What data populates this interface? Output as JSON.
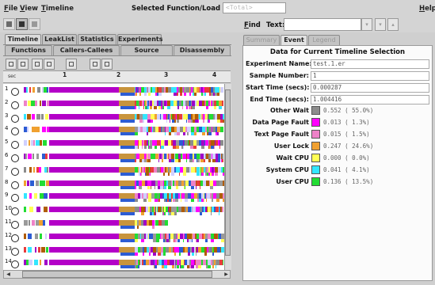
{
  "menubar": {
    "items": [
      {
        "label": "File",
        "hot": "F",
        "rest": "ile"
      },
      {
        "label": "View",
        "hot": "V",
        "rest": "iew"
      },
      {
        "label": "Timeline",
        "hot": "T",
        "rest": "imeline"
      }
    ],
    "help": {
      "hot": "H",
      "rest": "elp"
    },
    "selected_label": "Selected Function/Load Object:",
    "selected_value": "<Total>"
  },
  "find": {
    "label": "Find",
    "hot": "F",
    "rest": "ind",
    "type": "Text:",
    "value": ""
  },
  "left_tabs_row1": [
    "Timeline",
    "LeakList",
    "Statistics",
    "Experiments"
  ],
  "left_tabs_row2": [
    "Functions",
    "Callers-Callees",
    "Source",
    "Disassembly"
  ],
  "ruler": {
    "unit": "sec",
    "ticks": [
      "1",
      "2",
      "3",
      "4"
    ]
  },
  "rows": [
    {
      "label": "1"
    },
    {
      "label": "2"
    },
    {
      "label": "3"
    },
    {
      "label": "4"
    },
    {
      "label": "5"
    },
    {
      "label": "6"
    },
    {
      "label": "7"
    },
    {
      "label": "8"
    },
    {
      "label": "9"
    },
    {
      "label": "10"
    },
    {
      "label": "11"
    },
    {
      "label": "12"
    },
    {
      "label": "13"
    },
    {
      "label": "14"
    }
  ],
  "right_tabs": [
    "Summary",
    "Event",
    "Legend"
  ],
  "event": {
    "title": "Data for Current Timeline Selection",
    "fields": [
      {
        "label": "Experiment Name:",
        "value": "test.1.er"
      },
      {
        "label": "Sample Number:",
        "value": "1"
      },
      {
        "label": "Start Time (secs):",
        "value": "0.000287"
      },
      {
        "label": "End Time (secs):",
        "value": "1.004416"
      }
    ],
    "states": [
      {
        "label": "Other Wait",
        "color": "#8c8c8c",
        "value": "0.552 ( 55.0%)"
      },
      {
        "label": "Data Page Fault",
        "color": "#ff00ff",
        "value": "0.013 (  1.3%)"
      },
      {
        "label": "Text Page Fault",
        "color": "#ee82c8",
        "value": "0.015 (  1.5%)"
      },
      {
        "label": "User Lock",
        "color": "#f0a030",
        "value": "0.247 ( 24.6%)"
      },
      {
        "label": "Wait CPU",
        "color": "#ffff55",
        "value": "0.000 (  0.0%)"
      },
      {
        "label": "System CPU",
        "color": "#33e6ff",
        "value": "0.041 (  4.1%)"
      },
      {
        "label": "User CPU",
        "color": "#22dd33",
        "value": "0.136 ( 13.5%)"
      }
    ]
  }
}
